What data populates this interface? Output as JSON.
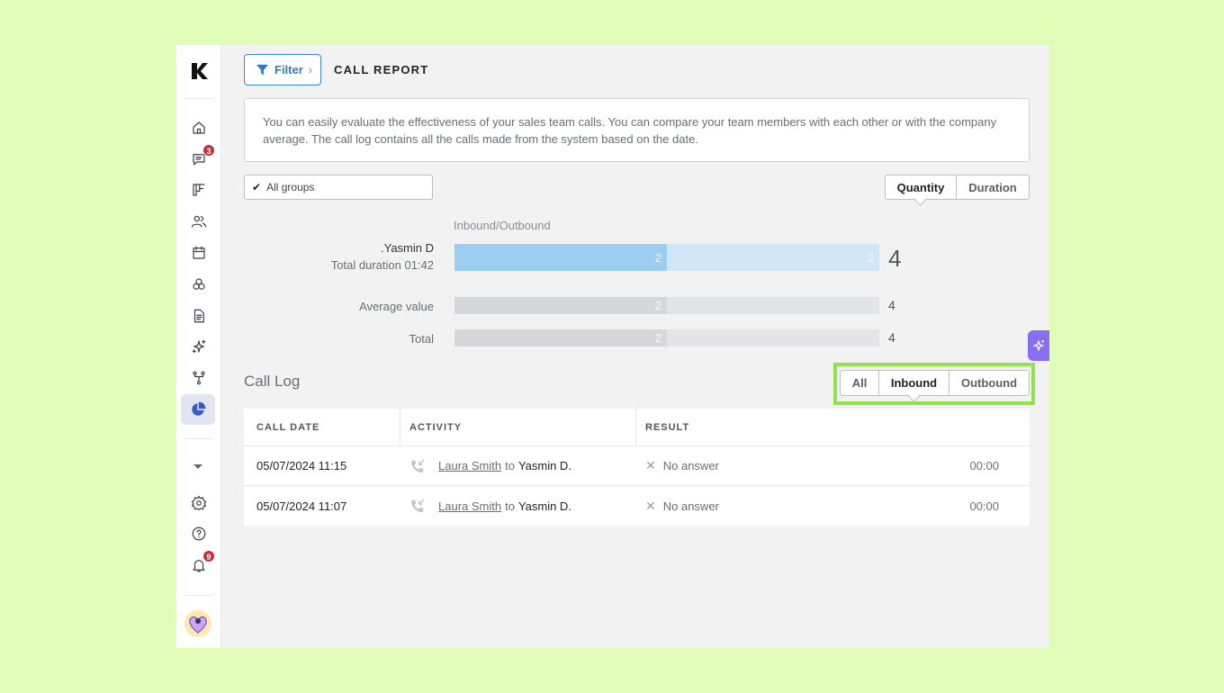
{
  "sidebar": {
    "logo": "K",
    "messages_badge": "3",
    "notifications_badge": "9",
    "icons": [
      "home-icon",
      "messages-icon",
      "board-icon",
      "people-icon",
      "calendar-icon",
      "groups-icon",
      "document-icon",
      "sparkles-icon",
      "workflow-icon",
      "reports-icon",
      "caret-down-icon",
      "settings-icon",
      "help-icon",
      "bell-icon"
    ]
  },
  "header": {
    "filter_label": "Filter",
    "filter_chevron": "›",
    "title": "CALL REPORT"
  },
  "info_text": "You can easily evaluate the effectiveness of your sales team calls. You can compare your team members with each other or with the company average. The call log contains all the calls made from the system based on the date.",
  "group_select": {
    "check": "✔",
    "value": "All groups"
  },
  "metric_toggle": {
    "options": [
      "Quantity",
      "Duration"
    ],
    "selected": "Quantity"
  },
  "chart": {
    "series_label": "Inbound/Outbound",
    "person": {
      "name": ".Yasmin D",
      "duration": "Total duration 01:42",
      "inbound": "2",
      "outbound": "2",
      "total": "4"
    },
    "average": {
      "label": "Average value",
      "inbound": "2",
      "total": "4"
    },
    "total": {
      "label": "Total",
      "inbound": "2",
      "total": "4"
    }
  },
  "call_log": {
    "title": "Call Log",
    "direction_toggle": {
      "options": [
        "All",
        "Inbound",
        "Outbound"
      ],
      "selected": "Inbound"
    },
    "columns": [
      "CALL DATE",
      "ACTIVITY",
      "RESULT"
    ],
    "rows": [
      {
        "date": "05/07/2024 11:15",
        "from": "Laura Smith",
        "to_word": "to",
        "to": "Yasmin D.",
        "result": "No answer",
        "duration": "00:00"
      },
      {
        "date": "05/07/2024 11:07",
        "from": "Laura Smith",
        "to_word": "to",
        "to": "Yasmin D.",
        "result": "No answer",
        "duration": "00:00"
      }
    ]
  },
  "colors": {
    "background": "#e0fcb8",
    "accent": "#3a86d6",
    "highlight": "#8fe34e",
    "badge": "#c6303e",
    "ai_tab": "#8a6ef0"
  }
}
